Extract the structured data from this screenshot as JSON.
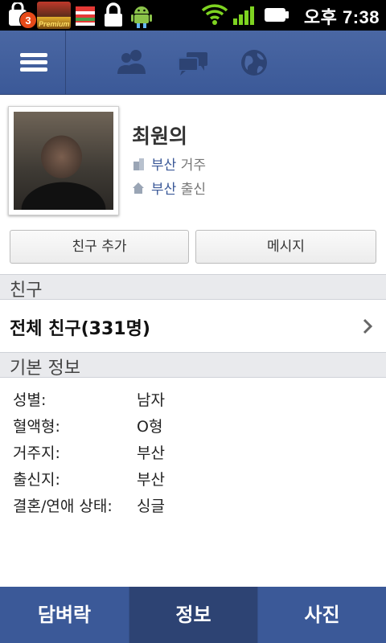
{
  "status_bar": {
    "notification_count": "3",
    "game_badge_text": "Premium",
    "time": "오후 7:38"
  },
  "nav": {
    "items": [
      "menu-icon",
      "friends-icon",
      "messages-icon",
      "globe-icon"
    ]
  },
  "profile": {
    "name": "최원의",
    "lives_in_city": "부산",
    "lives_in_suffix": "거주",
    "from_city": "부산",
    "from_suffix": "출신"
  },
  "actions": {
    "add_friend": "친구 추가",
    "message": "메시지"
  },
  "friends_section": {
    "header": "친구",
    "all_friends": "전체 친구(331명)"
  },
  "basic_info": {
    "header": "기본 정보",
    "rows": [
      {
        "key": "성별:",
        "value": "남자"
      },
      {
        "key": "혈액형:",
        "value": "O형"
      },
      {
        "key": "거주지:",
        "value": "부산"
      },
      {
        "key": "출신지:",
        "value": "부산"
      },
      {
        "key": "결혼/연애 상태:",
        "value": "싱글"
      }
    ]
  },
  "bottom_tabs": {
    "wall": "담벼락",
    "info": "정보",
    "photos": "사진",
    "active": "정보"
  },
  "colors": {
    "brand": "#3b5998",
    "brand_dark": "#2d4373",
    "section_bg": "#e9eaed"
  }
}
